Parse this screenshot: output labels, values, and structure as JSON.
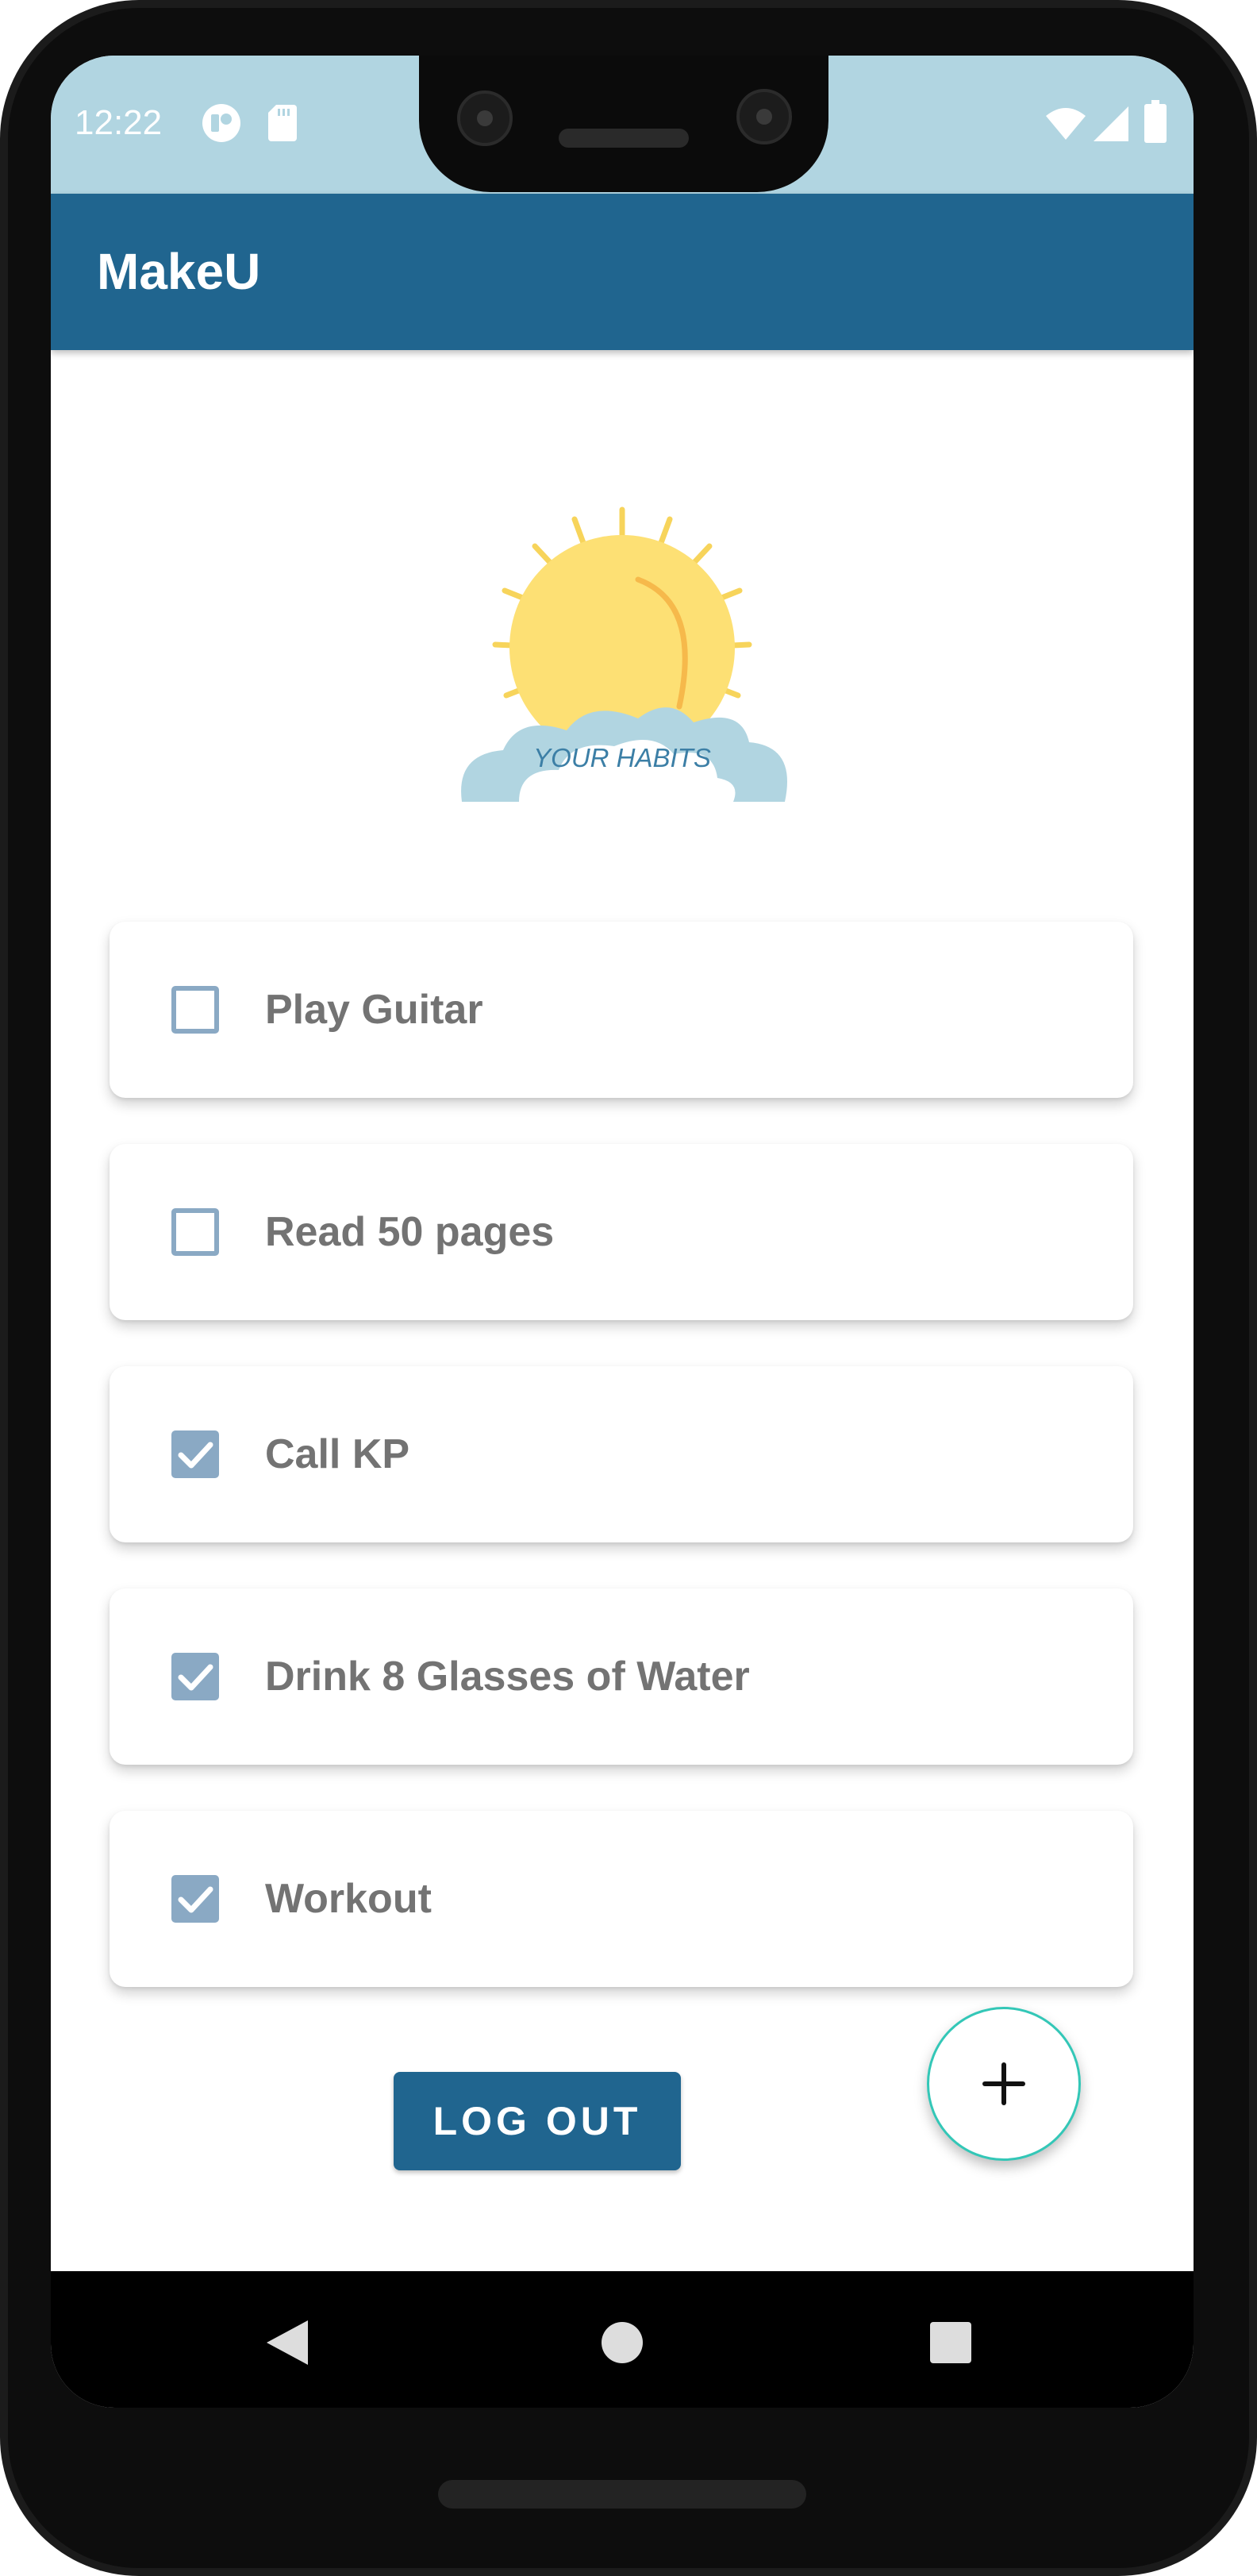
{
  "status_bar": {
    "time": "12:22",
    "left_icons": [
      "app-notification-icon",
      "sd-card-icon"
    ],
    "right_icons": [
      "wifi-icon",
      "cell-signal-icon",
      "battery-icon"
    ]
  },
  "app_bar": {
    "title": "MakeU"
  },
  "logo": {
    "text": "YOUR HABITS",
    "icon": "sun-over-cloud"
  },
  "habits": [
    {
      "label": "Play Guitar",
      "checked": false
    },
    {
      "label": "Read 50 pages",
      "checked": false
    },
    {
      "label": "Call KP",
      "checked": true
    },
    {
      "label": "Drink 8 Glasses of Water",
      "checked": true
    },
    {
      "label": "Workout",
      "checked": true
    }
  ],
  "logout_button": {
    "label": "LOG OUT"
  },
  "fab": {
    "icon": "plus-icon"
  },
  "nav_bar": {
    "icons": [
      "back-icon",
      "home-icon",
      "recents-icon"
    ]
  },
  "colors": {
    "primary": "#20658f",
    "status_bar": "#b1d5e1",
    "checkbox": "#8aa9c4",
    "fab_border": "#33c7b7",
    "habit_text": "#737373"
  }
}
